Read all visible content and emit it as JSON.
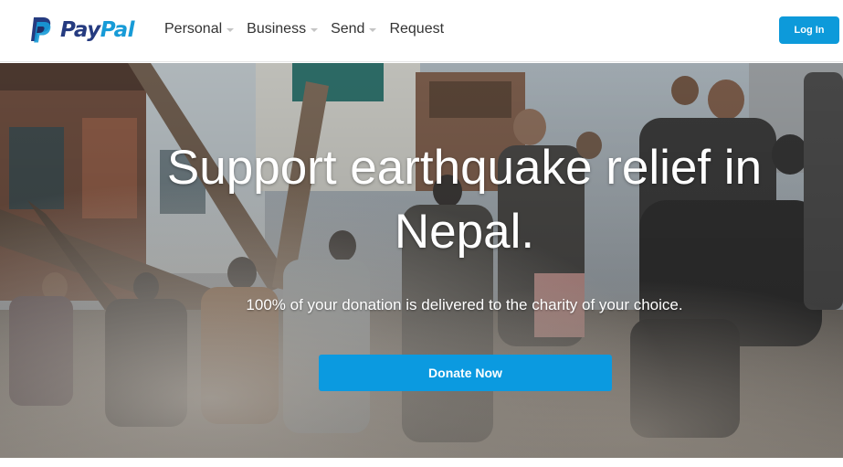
{
  "brand": {
    "name_part1": "Pay",
    "name_part2": "Pal",
    "colors": {
      "dark_blue": "#253b80",
      "light_blue": "#179bd7"
    }
  },
  "nav": {
    "items": [
      {
        "label": "Personal",
        "has_dropdown": true
      },
      {
        "label": "Business",
        "has_dropdown": true
      },
      {
        "label": "Send",
        "has_dropdown": true
      },
      {
        "label": "Request",
        "has_dropdown": false
      }
    ]
  },
  "header": {
    "login_label": "Log In",
    "login_color": "#0d9ada"
  },
  "hero": {
    "title_line1": "Support earthquake relief in",
    "title_line2": "Nepal.",
    "subtitle": "100% of your donation is delivered to the charity of your choice.",
    "cta_label": "Donate Now",
    "cta_color": "#0b9ae0",
    "image": "crowd-clearing-earthquake-rubble-photo"
  }
}
